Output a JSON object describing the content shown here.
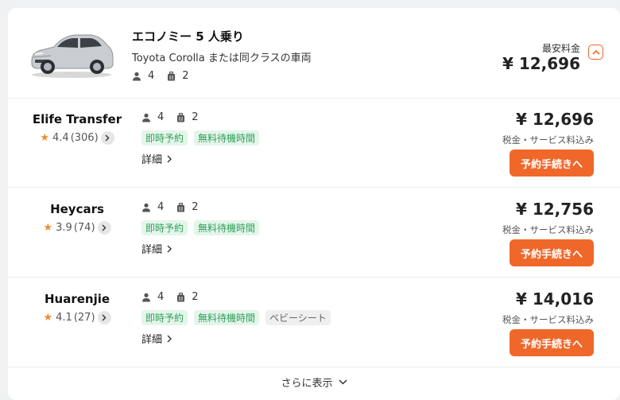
{
  "header": {
    "title": "エコノミー 5 人乗り",
    "subtitle": "Toyota Corolla または同クラスの車両",
    "passengers": "4",
    "luggage": "2",
    "lowest_label": "最安料金",
    "lowest_price": "¥ 12,696"
  },
  "offers": [
    {
      "vendor": "Elife Transfer",
      "rating": "4.4",
      "reviews": "(306)",
      "passengers": "4",
      "luggage": "2",
      "tags": [
        "即時予約",
        "無料待機時間"
      ],
      "details": "詳細",
      "price": "¥ 12,696",
      "tax_note": "税金・サービス料込み",
      "book_label": "予約手続きへ"
    },
    {
      "vendor": "Heycars",
      "rating": "3.9",
      "reviews": "(74)",
      "passengers": "4",
      "luggage": "2",
      "tags": [
        "即時予約",
        "無料待機時間"
      ],
      "details": "詳細",
      "price": "¥ 12,756",
      "tax_note": "税金・サービス料込み",
      "book_label": "予約手続きへ"
    },
    {
      "vendor": "Huarenjie",
      "rating": "4.1",
      "reviews": "(27)",
      "passengers": "4",
      "luggage": "2",
      "tags": [
        "即時予約",
        "無料待機時間",
        "ベビーシート"
      ],
      "details": "詳細",
      "price": "¥ 14,016",
      "tax_note": "税金・サービス料込み",
      "book_label": "予約手続きへ"
    }
  ],
  "show_more": "さらに表示",
  "colors": {
    "accent": "#f0672a",
    "tag_green_bg": "#e4f5ea",
    "tag_green_text": "#2fa05a",
    "star": "#f08a2a"
  }
}
